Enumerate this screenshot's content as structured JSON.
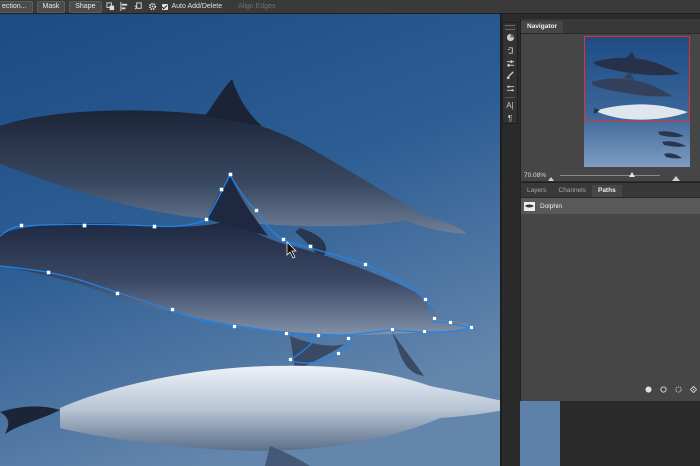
{
  "options_bar": {
    "selection_label": "ection...",
    "mask_label": "Mask",
    "shape_label": "Shape",
    "auto_add_delete_label": "Auto Add/Delete",
    "auto_add_delete_checked": true,
    "align_edges_label": "Align Edges",
    "icons": [
      "path-operations-icon",
      "path-alignment-icon",
      "path-arrangement-icon",
      "gear-icon"
    ]
  },
  "tool_strip": {
    "tools": [
      "color-wheel-icon",
      "history-icon",
      "adjustments-icon",
      "brush-icon",
      "properties-icon",
      "character-icon",
      "paragraph-icon"
    ],
    "character_glyph": "A|",
    "paragraph_glyph": "¶"
  },
  "navigator": {
    "tab_label": "Navigator",
    "zoom_value": "70.08%",
    "zoom_fraction": 0.72
  },
  "paths_panel": {
    "tabs": [
      {
        "label": "Layers",
        "active": false
      },
      {
        "label": "Channels",
        "active": false
      },
      {
        "label": "Paths",
        "active": true
      }
    ],
    "items": [
      {
        "name": "Dolphin",
        "selected": true
      }
    ],
    "footer_icons": [
      "fill-path-icon",
      "stroke-path-icon",
      "load-selection-icon",
      "make-work-path-icon"
    ]
  },
  "colors": {
    "accent": "#1473e6",
    "panel_bg": "#464646",
    "ocean_top": "#1f4f86",
    "ocean_bottom": "#5a7fa6"
  }
}
